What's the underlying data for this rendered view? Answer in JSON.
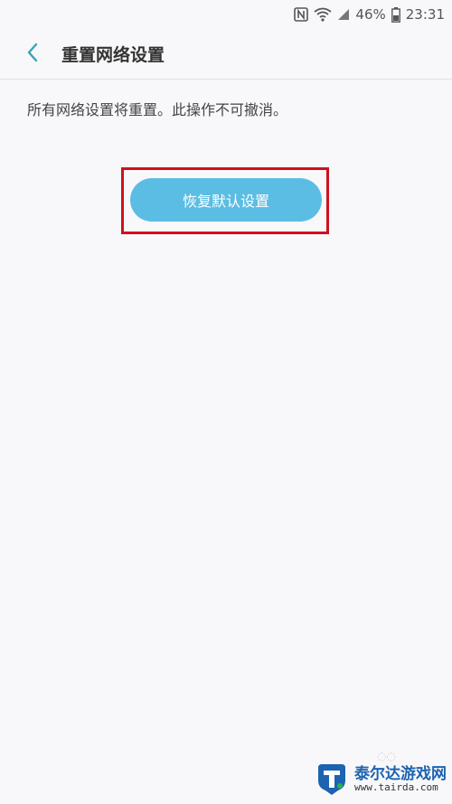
{
  "status_bar": {
    "nfc_icon": "nfc-icon",
    "wifi_icon": "wifi-icon",
    "signal_icon": "signal-icon",
    "battery_percent": "46%",
    "battery_icon": "battery-icon",
    "time": "23:31"
  },
  "header": {
    "back_icon": "chevron-left-icon",
    "title": "重置网络设置"
  },
  "main": {
    "description": "所有网络设置将重置。此操作不可撤消。",
    "reset_button_label": "恢复默认设置"
  },
  "watermark": {
    "title": "泰尔达游戏网",
    "url": "www.tairda.com"
  },
  "colors": {
    "accent": "#5bbde3",
    "back_arrow": "#3aa2b7",
    "highlight": "#d0101f",
    "background": "#f8f8fa"
  }
}
